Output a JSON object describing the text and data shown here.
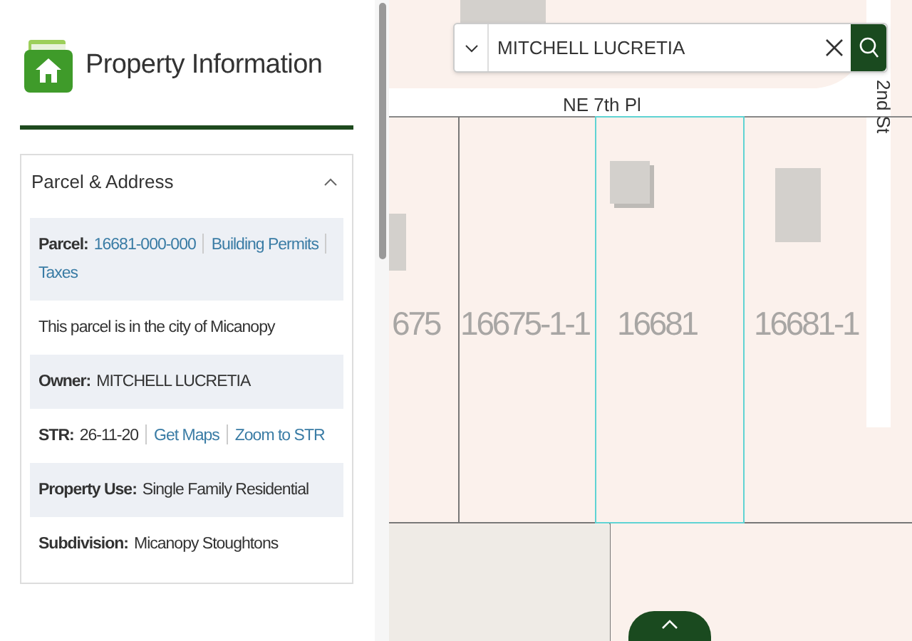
{
  "header": {
    "title": "Property Information"
  },
  "section": {
    "title": "Parcel & Address",
    "expanded": true,
    "rows": [
      {
        "label": "Parcel:",
        "parts": [
          {
            "kind": "link",
            "text": "16681-000-000"
          },
          {
            "kind": "link",
            "text": "Building Permits"
          },
          {
            "kind": "link",
            "text": "Taxes"
          }
        ]
      },
      {
        "parts": [
          {
            "kind": "text",
            "text": "This parcel is in the city of Micanopy"
          }
        ]
      },
      {
        "label": "Owner:",
        "parts": [
          {
            "kind": "text",
            "text": "MITCHELL LUCRETIA"
          }
        ]
      },
      {
        "label": "STR:",
        "parts": [
          {
            "kind": "text",
            "text": "26-11-20"
          },
          {
            "kind": "link",
            "text": "Get Maps"
          },
          {
            "kind": "link",
            "text": "Zoom to STR"
          }
        ]
      },
      {
        "label": "Property Use:",
        "parts": [
          {
            "kind": "text",
            "text": "Single Family Residential"
          }
        ]
      },
      {
        "label": "Subdivision:",
        "parts": [
          {
            "kind": "text",
            "text": "Micanopy Stoughtons"
          }
        ]
      }
    ]
  },
  "search": {
    "value": "MITCHELL LUCRETIA"
  },
  "map": {
    "road_labels": [
      "NE 7th Pl",
      "2nd St"
    ],
    "parcel_labels": [
      "675",
      "16675-1-1",
      "16681",
      "16681-1"
    ]
  }
}
